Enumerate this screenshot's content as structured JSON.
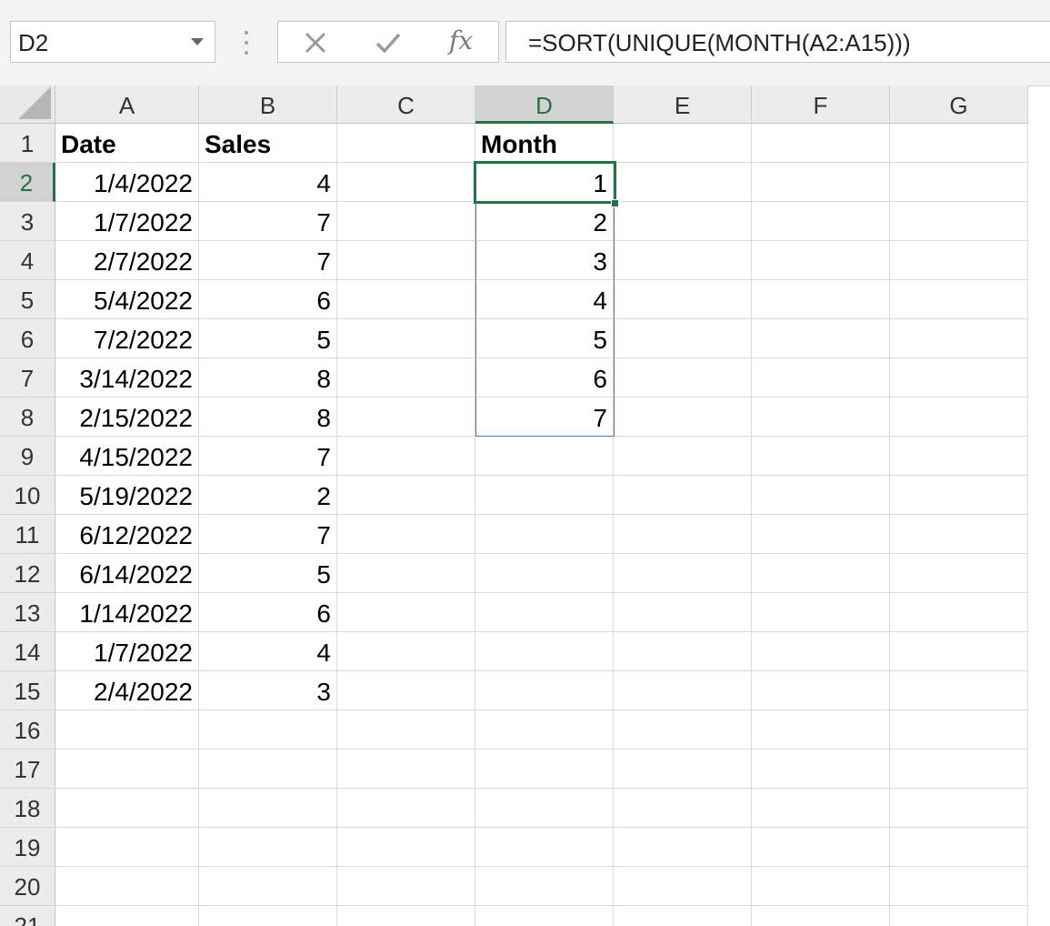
{
  "formula_bar": {
    "name_box": "D2",
    "formula": "=SORT(UNIQUE(MONTH(A2:A15)))",
    "insert_function_label": "fx"
  },
  "sheet": {
    "columns": [
      "A",
      "B",
      "C",
      "D",
      "E",
      "F",
      "G"
    ],
    "active_column": "D",
    "active_row": "2",
    "rows": [
      {
        "n": "1",
        "A": "Date",
        "B": "Sales",
        "D": "Month"
      },
      {
        "n": "2",
        "A": "1/4/2022",
        "B": "4",
        "D": "1"
      },
      {
        "n": "3",
        "A": "1/7/2022",
        "B": "7",
        "D": "2"
      },
      {
        "n": "4",
        "A": "2/7/2022",
        "B": "7",
        "D": "3"
      },
      {
        "n": "5",
        "A": "5/4/2022",
        "B": "6",
        "D": "4"
      },
      {
        "n": "6",
        "A": "7/2/2022",
        "B": "5",
        "D": "5"
      },
      {
        "n": "7",
        "A": "3/14/2022",
        "B": "8",
        "D": "6"
      },
      {
        "n": "8",
        "A": "2/15/2022",
        "B": "8",
        "D": "7"
      },
      {
        "n": "9",
        "A": "4/15/2022",
        "B": "7"
      },
      {
        "n": "10",
        "A": "5/19/2022",
        "B": "2"
      },
      {
        "n": "11",
        "A": "6/12/2022",
        "B": "7"
      },
      {
        "n": "12",
        "A": "6/14/2022",
        "B": "5"
      },
      {
        "n": "13",
        "A": "1/14/2022",
        "B": "6"
      },
      {
        "n": "14",
        "A": "1/7/2022",
        "B": "4"
      },
      {
        "n": "15",
        "A": "2/4/2022",
        "B": "3"
      },
      {
        "n": "16"
      },
      {
        "n": "17"
      },
      {
        "n": "18"
      },
      {
        "n": "19"
      },
      {
        "n": "20"
      },
      {
        "n": "21"
      }
    ]
  },
  "colors": {
    "accent": "#217346",
    "spill_border": "#4a7ebb"
  }
}
